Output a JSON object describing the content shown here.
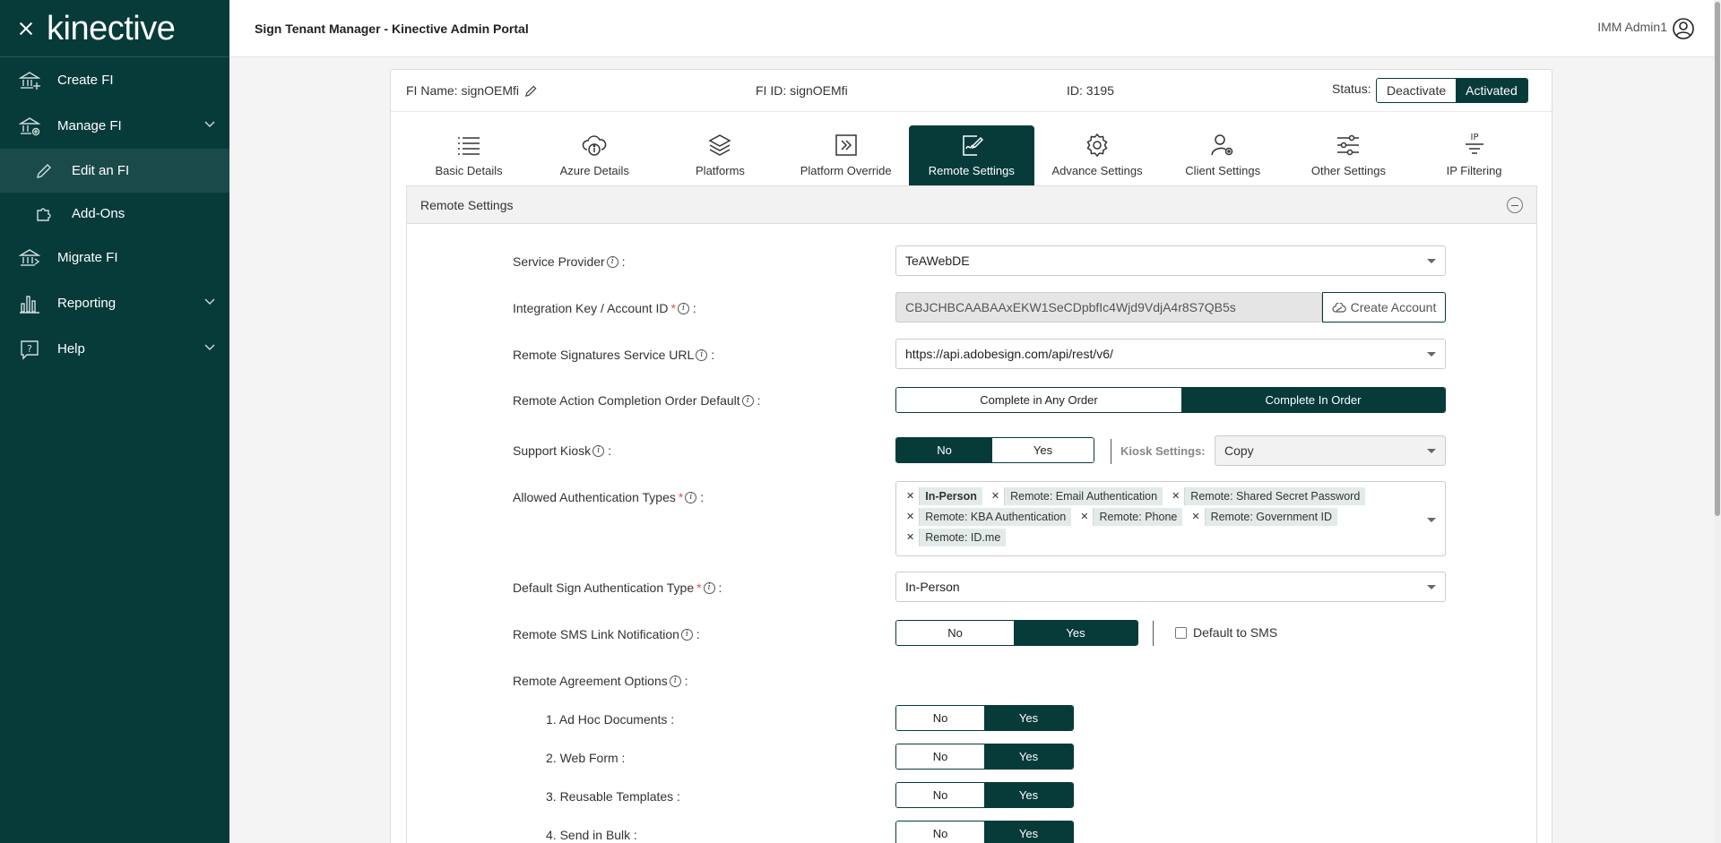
{
  "sidebar": {
    "logo": "kinective",
    "items": [
      {
        "label": "Create FI",
        "icon": "bank-plus-icon"
      },
      {
        "label": "Manage FI",
        "icon": "bank-gear-icon"
      },
      {
        "label": "Edit an FI",
        "icon": "pencil-icon"
      },
      {
        "label": "Add-Ons",
        "icon": "puzzle-icon"
      },
      {
        "label": "Migrate FI",
        "icon": "bank-migrate-icon"
      },
      {
        "label": "Reporting",
        "icon": "bar-chart-icon"
      },
      {
        "label": "Help",
        "icon": "help-icon"
      }
    ]
  },
  "topbar": {
    "title": "Sign Tenant Manager - Kinective Admin Portal",
    "user": "IMM Admin1"
  },
  "header": {
    "fi_name": "FI Name: signOEMfi",
    "fi_id": "FI ID: signOEMfi",
    "id": "ID: 3195",
    "status_label": "Status:",
    "deactivate": "Deactivate",
    "activated": "Activated"
  },
  "tabs": [
    {
      "label": "Basic Details",
      "icon": "list-icon"
    },
    {
      "label": "Azure Details",
      "icon": "cloud-info-icon"
    },
    {
      "label": "Platforms",
      "icon": "layers-icon"
    },
    {
      "label": "Platform Override",
      "icon": "override-icon"
    },
    {
      "label": "Remote Settings",
      "icon": "remote-sign-icon"
    },
    {
      "label": "Advance Settings",
      "icon": "gear-icon"
    },
    {
      "label": "Client Settings",
      "icon": "user-gear-icon"
    },
    {
      "label": "Other Settings",
      "icon": "sliders-icon"
    },
    {
      "label": "IP Filtering",
      "icon": "ip-filter-icon"
    }
  ],
  "section": {
    "title": "Remote Settings"
  },
  "form": {
    "service_provider": {
      "label": "Service Provider",
      "value": "TeAWebDE"
    },
    "integration_key": {
      "label": "Integration Key / Account ID",
      "value": "CBJCHBCAABAAxEKW1SeCDpbfIc4Wjd9VdjA4r8S7QB5s",
      "button": "Create Account"
    },
    "service_url": {
      "label": "Remote Signatures Service URL",
      "value": "https://api.adobesign.com/api/rest/v6/"
    },
    "completion_order": {
      "label": "Remote Action Completion Order Default",
      "opt1": "Complete in Any Order",
      "opt2": "Complete In Order"
    },
    "support_kiosk": {
      "label": "Support Kiosk",
      "no": "No",
      "yes": "Yes",
      "kiosk_label": "Kiosk Settings:",
      "kiosk_value": "Copy"
    },
    "auth_types": {
      "label": "Allowed Authentication Types",
      "chips": [
        "In-Person",
        "Remote: Email Authentication",
        "Remote: Shared Secret Password",
        "Remote: KBA Authentication",
        "Remote: Phone",
        "Remote: Government ID",
        "Remote: ID.me"
      ]
    },
    "default_auth": {
      "label": "Default Sign Authentication Type",
      "value": "In-Person"
    },
    "sms": {
      "label": "Remote SMS Link Notification",
      "no": "No",
      "yes": "Yes",
      "default_label": "Default to SMS"
    },
    "agreement": {
      "label": "Remote Agreement Options"
    },
    "options": [
      {
        "label": "1. Ad Hoc Documents :",
        "no": "No",
        "yes": "Yes"
      },
      {
        "label": "2. Web Form :",
        "no": "No",
        "yes": "Yes"
      },
      {
        "label": "3. Reusable Templates :",
        "no": "No",
        "yes": "Yes"
      },
      {
        "label": "4. Send in Bulk :",
        "no": "No",
        "yes": "Yes"
      }
    ],
    "colon": ":"
  },
  "colors": {
    "brand": "#073b3a",
    "required": "#d9534f"
  }
}
